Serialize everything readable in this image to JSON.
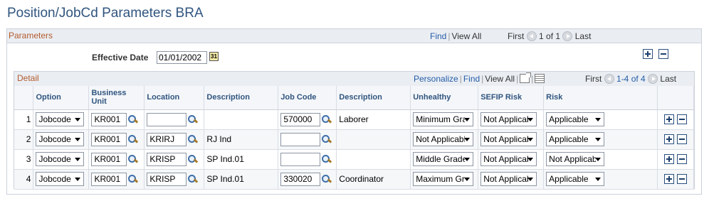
{
  "page": {
    "title": "Position/JobCd Parameters BRA"
  },
  "params": {
    "label": "Parameters",
    "find": "Find",
    "view_all": "View All",
    "first": "First",
    "count": "1 of 1",
    "last": "Last",
    "effective_date_label": "Effective Date",
    "effective_date": "01/01/2002",
    "calendar_icon": "calendar-icon"
  },
  "detail": {
    "label": "Detail",
    "personalize": "Personalize",
    "find": "Find",
    "view_all": "View All",
    "first": "First",
    "count": "1-4 of 4",
    "last": "Last",
    "columns": {
      "option": "Option",
      "business_unit": "Business Unit",
      "location": "Location",
      "description": "Description",
      "job_code": "Job Code",
      "description2": "Description",
      "unhealthy": "Unhealthy",
      "sefip_risk": "SEFIP Risk",
      "risk": "Risk"
    },
    "rows": [
      {
        "num": "1",
        "option": "Jobcode",
        "bu": "KR001",
        "location": "",
        "loc_desc": "",
        "job_code": "570000",
        "job_desc": "Laborer",
        "unhealthy": "Minimum Grade",
        "sefip": "Not Applicable",
        "risk": "Applicable"
      },
      {
        "num": "2",
        "option": "Jobcode",
        "bu": "KR001",
        "location": "KRIRJ",
        "loc_desc": "RJ Ind",
        "job_code": "",
        "job_desc": "",
        "unhealthy": "Not Applicable",
        "sefip": "Not Applicable",
        "risk": "Applicable"
      },
      {
        "num": "3",
        "option": "Jobcode",
        "bu": "KR001",
        "location": "KRISP",
        "loc_desc": "SP Ind.01",
        "job_code": "",
        "job_desc": "",
        "unhealthy": "Middle Grade",
        "sefip": "Not Applicable",
        "risk": "Not Applicable"
      },
      {
        "num": "4",
        "option": "Jobcode",
        "bu": "KR001",
        "location": "KRISP",
        "loc_desc": "SP Ind.01",
        "job_code": "330020",
        "job_desc": "Coordinator",
        "unhealthy": "Maximum Grade",
        "sefip": "Not Applicable",
        "risk": "Applicable"
      }
    ]
  },
  "colors": {
    "title": "#30557f",
    "section_label": "#b35a2d",
    "link": "#255da8",
    "header_bg": "#eaeef3"
  }
}
